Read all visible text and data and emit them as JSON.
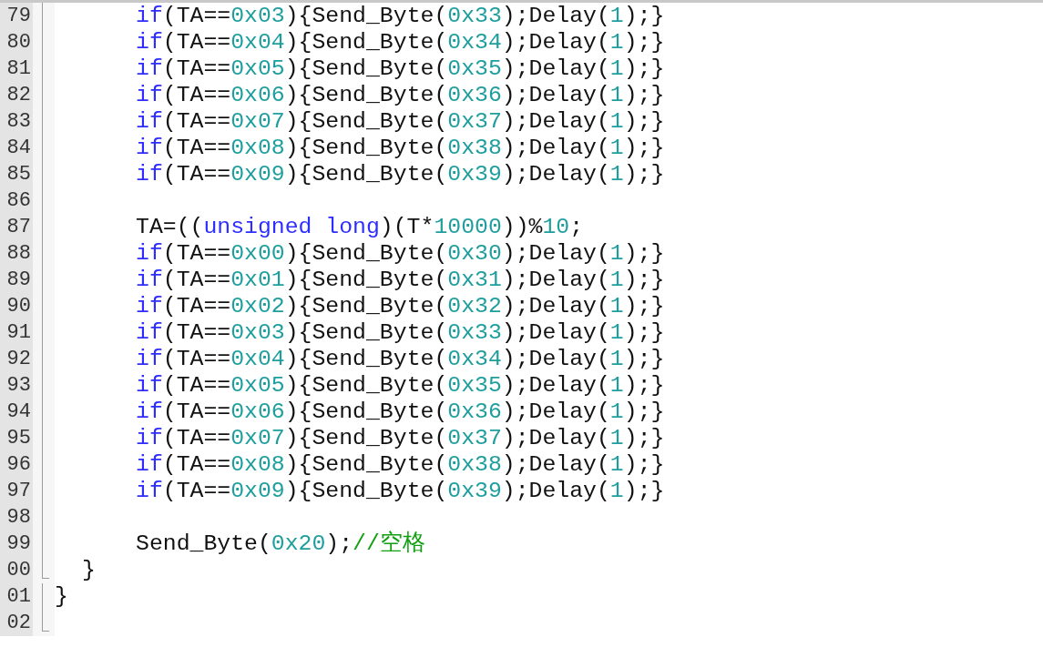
{
  "editor": {
    "lines": [
      {
        "number": "79",
        "fold_end": false,
        "kind": "body",
        "tokens": [
          {
            "kind": "keyword",
            "text": "if"
          },
          {
            "kind": "plain",
            "text": "(TA=="
          },
          {
            "kind": "number",
            "text": "0x03"
          },
          {
            "kind": "plain",
            "text": "){Send_Byte("
          },
          {
            "kind": "number",
            "text": "0x33"
          },
          {
            "kind": "plain",
            "text": ");Delay("
          },
          {
            "kind": "number",
            "text": "1"
          },
          {
            "kind": "plain",
            "text": ");}"
          }
        ]
      },
      {
        "number": "80",
        "fold_end": false,
        "kind": "body",
        "tokens": [
          {
            "kind": "keyword",
            "text": "if"
          },
          {
            "kind": "plain",
            "text": "(TA=="
          },
          {
            "kind": "number",
            "text": "0x04"
          },
          {
            "kind": "plain",
            "text": "){Send_Byte("
          },
          {
            "kind": "number",
            "text": "0x34"
          },
          {
            "kind": "plain",
            "text": ");Delay("
          },
          {
            "kind": "number",
            "text": "1"
          },
          {
            "kind": "plain",
            "text": ");}"
          }
        ]
      },
      {
        "number": "81",
        "fold_end": false,
        "kind": "body",
        "tokens": [
          {
            "kind": "keyword",
            "text": "if"
          },
          {
            "kind": "plain",
            "text": "(TA=="
          },
          {
            "kind": "number",
            "text": "0x05"
          },
          {
            "kind": "plain",
            "text": "){Send_Byte("
          },
          {
            "kind": "number",
            "text": "0x35"
          },
          {
            "kind": "plain",
            "text": ");Delay("
          },
          {
            "kind": "number",
            "text": "1"
          },
          {
            "kind": "plain",
            "text": ");}"
          }
        ]
      },
      {
        "number": "82",
        "fold_end": false,
        "kind": "body",
        "tokens": [
          {
            "kind": "keyword",
            "text": "if"
          },
          {
            "kind": "plain",
            "text": "(TA=="
          },
          {
            "kind": "number",
            "text": "0x06"
          },
          {
            "kind": "plain",
            "text": "){Send_Byte("
          },
          {
            "kind": "number",
            "text": "0x36"
          },
          {
            "kind": "plain",
            "text": ");Delay("
          },
          {
            "kind": "number",
            "text": "1"
          },
          {
            "kind": "plain",
            "text": ");}"
          }
        ]
      },
      {
        "number": "83",
        "fold_end": false,
        "kind": "body",
        "tokens": [
          {
            "kind": "keyword",
            "text": "if"
          },
          {
            "kind": "plain",
            "text": "(TA=="
          },
          {
            "kind": "number",
            "text": "0x07"
          },
          {
            "kind": "plain",
            "text": "){Send_Byte("
          },
          {
            "kind": "number",
            "text": "0x37"
          },
          {
            "kind": "plain",
            "text": ");Delay("
          },
          {
            "kind": "number",
            "text": "1"
          },
          {
            "kind": "plain",
            "text": ");}"
          }
        ]
      },
      {
        "number": "84",
        "fold_end": false,
        "kind": "body",
        "tokens": [
          {
            "kind": "keyword",
            "text": "if"
          },
          {
            "kind": "plain",
            "text": "(TA=="
          },
          {
            "kind": "number",
            "text": "0x08"
          },
          {
            "kind": "plain",
            "text": "){Send_Byte("
          },
          {
            "kind": "number",
            "text": "0x38"
          },
          {
            "kind": "plain",
            "text": ");Delay("
          },
          {
            "kind": "number",
            "text": "1"
          },
          {
            "kind": "plain",
            "text": ");}"
          }
        ]
      },
      {
        "number": "85",
        "fold_end": false,
        "kind": "body",
        "tokens": [
          {
            "kind": "keyword",
            "text": "if"
          },
          {
            "kind": "plain",
            "text": "(TA=="
          },
          {
            "kind": "number",
            "text": "0x09"
          },
          {
            "kind": "plain",
            "text": "){Send_Byte("
          },
          {
            "kind": "number",
            "text": "0x39"
          },
          {
            "kind": "plain",
            "text": ");Delay("
          },
          {
            "kind": "number",
            "text": "1"
          },
          {
            "kind": "plain",
            "text": ");}"
          }
        ]
      },
      {
        "number": "86",
        "fold_end": false
      },
      {
        "number": "87",
        "fold_end": false,
        "kind": "body",
        "tokens": [
          {
            "kind": "plain",
            "text": "TA=(("
          },
          {
            "kind": "keyword",
            "text": "unsigned long"
          },
          {
            "kind": "plain",
            "text": ")(T*"
          },
          {
            "kind": "number",
            "text": "10000"
          },
          {
            "kind": "plain",
            "text": "))%"
          },
          {
            "kind": "number",
            "text": "10"
          },
          {
            "kind": "plain",
            "text": ";"
          }
        ]
      },
      {
        "number": "88",
        "fold_end": false,
        "kind": "body",
        "tokens": [
          {
            "kind": "keyword",
            "text": "if"
          },
          {
            "kind": "plain",
            "text": "(TA=="
          },
          {
            "kind": "number",
            "text": "0x00"
          },
          {
            "kind": "plain",
            "text": "){Send_Byte("
          },
          {
            "kind": "number",
            "text": "0x30"
          },
          {
            "kind": "plain",
            "text": ");Delay("
          },
          {
            "kind": "number",
            "text": "1"
          },
          {
            "kind": "plain",
            "text": ");}"
          }
        ]
      },
      {
        "number": "89",
        "fold_end": false,
        "kind": "body",
        "tokens": [
          {
            "kind": "keyword",
            "text": "if"
          },
          {
            "kind": "plain",
            "text": "(TA=="
          },
          {
            "kind": "number",
            "text": "0x01"
          },
          {
            "kind": "plain",
            "text": "){Send_Byte("
          },
          {
            "kind": "number",
            "text": "0x31"
          },
          {
            "kind": "plain",
            "text": ");Delay("
          },
          {
            "kind": "number",
            "text": "1"
          },
          {
            "kind": "plain",
            "text": ");}"
          }
        ]
      },
      {
        "number": "90",
        "fold_end": false,
        "kind": "body",
        "tokens": [
          {
            "kind": "keyword",
            "text": "if"
          },
          {
            "kind": "plain",
            "text": "(TA=="
          },
          {
            "kind": "number",
            "text": "0x02"
          },
          {
            "kind": "plain",
            "text": "){Send_Byte("
          },
          {
            "kind": "number",
            "text": "0x32"
          },
          {
            "kind": "plain",
            "text": ");Delay("
          },
          {
            "kind": "number",
            "text": "1"
          },
          {
            "kind": "plain",
            "text": ");}"
          }
        ]
      },
      {
        "number": "91",
        "fold_end": false,
        "kind": "body",
        "tokens": [
          {
            "kind": "keyword",
            "text": "if"
          },
          {
            "kind": "plain",
            "text": "(TA=="
          },
          {
            "kind": "number",
            "text": "0x03"
          },
          {
            "kind": "plain",
            "text": "){Send_Byte("
          },
          {
            "kind": "number",
            "text": "0x33"
          },
          {
            "kind": "plain",
            "text": ");Delay("
          },
          {
            "kind": "number",
            "text": "1"
          },
          {
            "kind": "plain",
            "text": ");}"
          }
        ]
      },
      {
        "number": "92",
        "fold_end": false,
        "kind": "body",
        "tokens": [
          {
            "kind": "keyword",
            "text": "if"
          },
          {
            "kind": "plain",
            "text": "(TA=="
          },
          {
            "kind": "number",
            "text": "0x04"
          },
          {
            "kind": "plain",
            "text": "){Send_Byte("
          },
          {
            "kind": "number",
            "text": "0x34"
          },
          {
            "kind": "plain",
            "text": ");Delay("
          },
          {
            "kind": "number",
            "text": "1"
          },
          {
            "kind": "plain",
            "text": ");}"
          }
        ]
      },
      {
        "number": "93",
        "fold_end": false,
        "kind": "body",
        "tokens": [
          {
            "kind": "keyword",
            "text": "if"
          },
          {
            "kind": "plain",
            "text": "(TA=="
          },
          {
            "kind": "number",
            "text": "0x05"
          },
          {
            "kind": "plain",
            "text": "){Send_Byte("
          },
          {
            "kind": "number",
            "text": "0x35"
          },
          {
            "kind": "plain",
            "text": ");Delay("
          },
          {
            "kind": "number",
            "text": "1"
          },
          {
            "kind": "plain",
            "text": ");}"
          }
        ]
      },
      {
        "number": "94",
        "fold_end": false,
        "kind": "body",
        "tokens": [
          {
            "kind": "keyword",
            "text": "if"
          },
          {
            "kind": "plain",
            "text": "(TA=="
          },
          {
            "kind": "number",
            "text": "0x06"
          },
          {
            "kind": "plain",
            "text": "){Send_Byte("
          },
          {
            "kind": "number",
            "text": "0x36"
          },
          {
            "kind": "plain",
            "text": ");Delay("
          },
          {
            "kind": "number",
            "text": "1"
          },
          {
            "kind": "plain",
            "text": ");}"
          }
        ]
      },
      {
        "number": "95",
        "fold_end": false,
        "kind": "body",
        "tokens": [
          {
            "kind": "keyword",
            "text": "if"
          },
          {
            "kind": "plain",
            "text": "(TA=="
          },
          {
            "kind": "number",
            "text": "0x07"
          },
          {
            "kind": "plain",
            "text": "){Send_Byte("
          },
          {
            "kind": "number",
            "text": "0x37"
          },
          {
            "kind": "plain",
            "text": ");Delay("
          },
          {
            "kind": "number",
            "text": "1"
          },
          {
            "kind": "plain",
            "text": ");}"
          }
        ]
      },
      {
        "number": "96",
        "fold_end": false,
        "kind": "body",
        "tokens": [
          {
            "kind": "keyword",
            "text": "if"
          },
          {
            "kind": "plain",
            "text": "(TA=="
          },
          {
            "kind": "number",
            "text": "0x08"
          },
          {
            "kind": "plain",
            "text": "){Send_Byte("
          },
          {
            "kind": "number",
            "text": "0x38"
          },
          {
            "kind": "plain",
            "text": ");Delay("
          },
          {
            "kind": "number",
            "text": "1"
          },
          {
            "kind": "plain",
            "text": ");}"
          }
        ]
      },
      {
        "number": "97",
        "fold_end": false,
        "kind": "body",
        "tokens": [
          {
            "kind": "keyword",
            "text": "if"
          },
          {
            "kind": "plain",
            "text": "(TA=="
          },
          {
            "kind": "number",
            "text": "0x09"
          },
          {
            "kind": "plain",
            "text": "){Send_Byte("
          },
          {
            "kind": "number",
            "text": "0x39"
          },
          {
            "kind": "plain",
            "text": ");Delay("
          },
          {
            "kind": "number",
            "text": "1"
          },
          {
            "kind": "plain",
            "text": ");}"
          }
        ]
      },
      {
        "number": "98",
        "fold_end": false
      },
      {
        "number": "99",
        "fold_end": false,
        "kind": "body",
        "tokens": [
          {
            "kind": "plain",
            "text": "Send_Byte("
          },
          {
            "kind": "number",
            "text": "0x20"
          },
          {
            "kind": "plain",
            "text": ");"
          },
          {
            "kind": "comment",
            "text": "//空格"
          }
        ]
      },
      {
        "number": "00",
        "fold_end": true,
        "kind": "block",
        "tokens": [
          {
            "kind": "plain",
            "text": "}"
          }
        ]
      },
      {
        "number": "01",
        "fold_end": false,
        "kind": "top",
        "tokens": [
          {
            "kind": "plain",
            "text": "}"
          }
        ]
      },
      {
        "number": "02",
        "fold_end": true
      }
    ]
  }
}
